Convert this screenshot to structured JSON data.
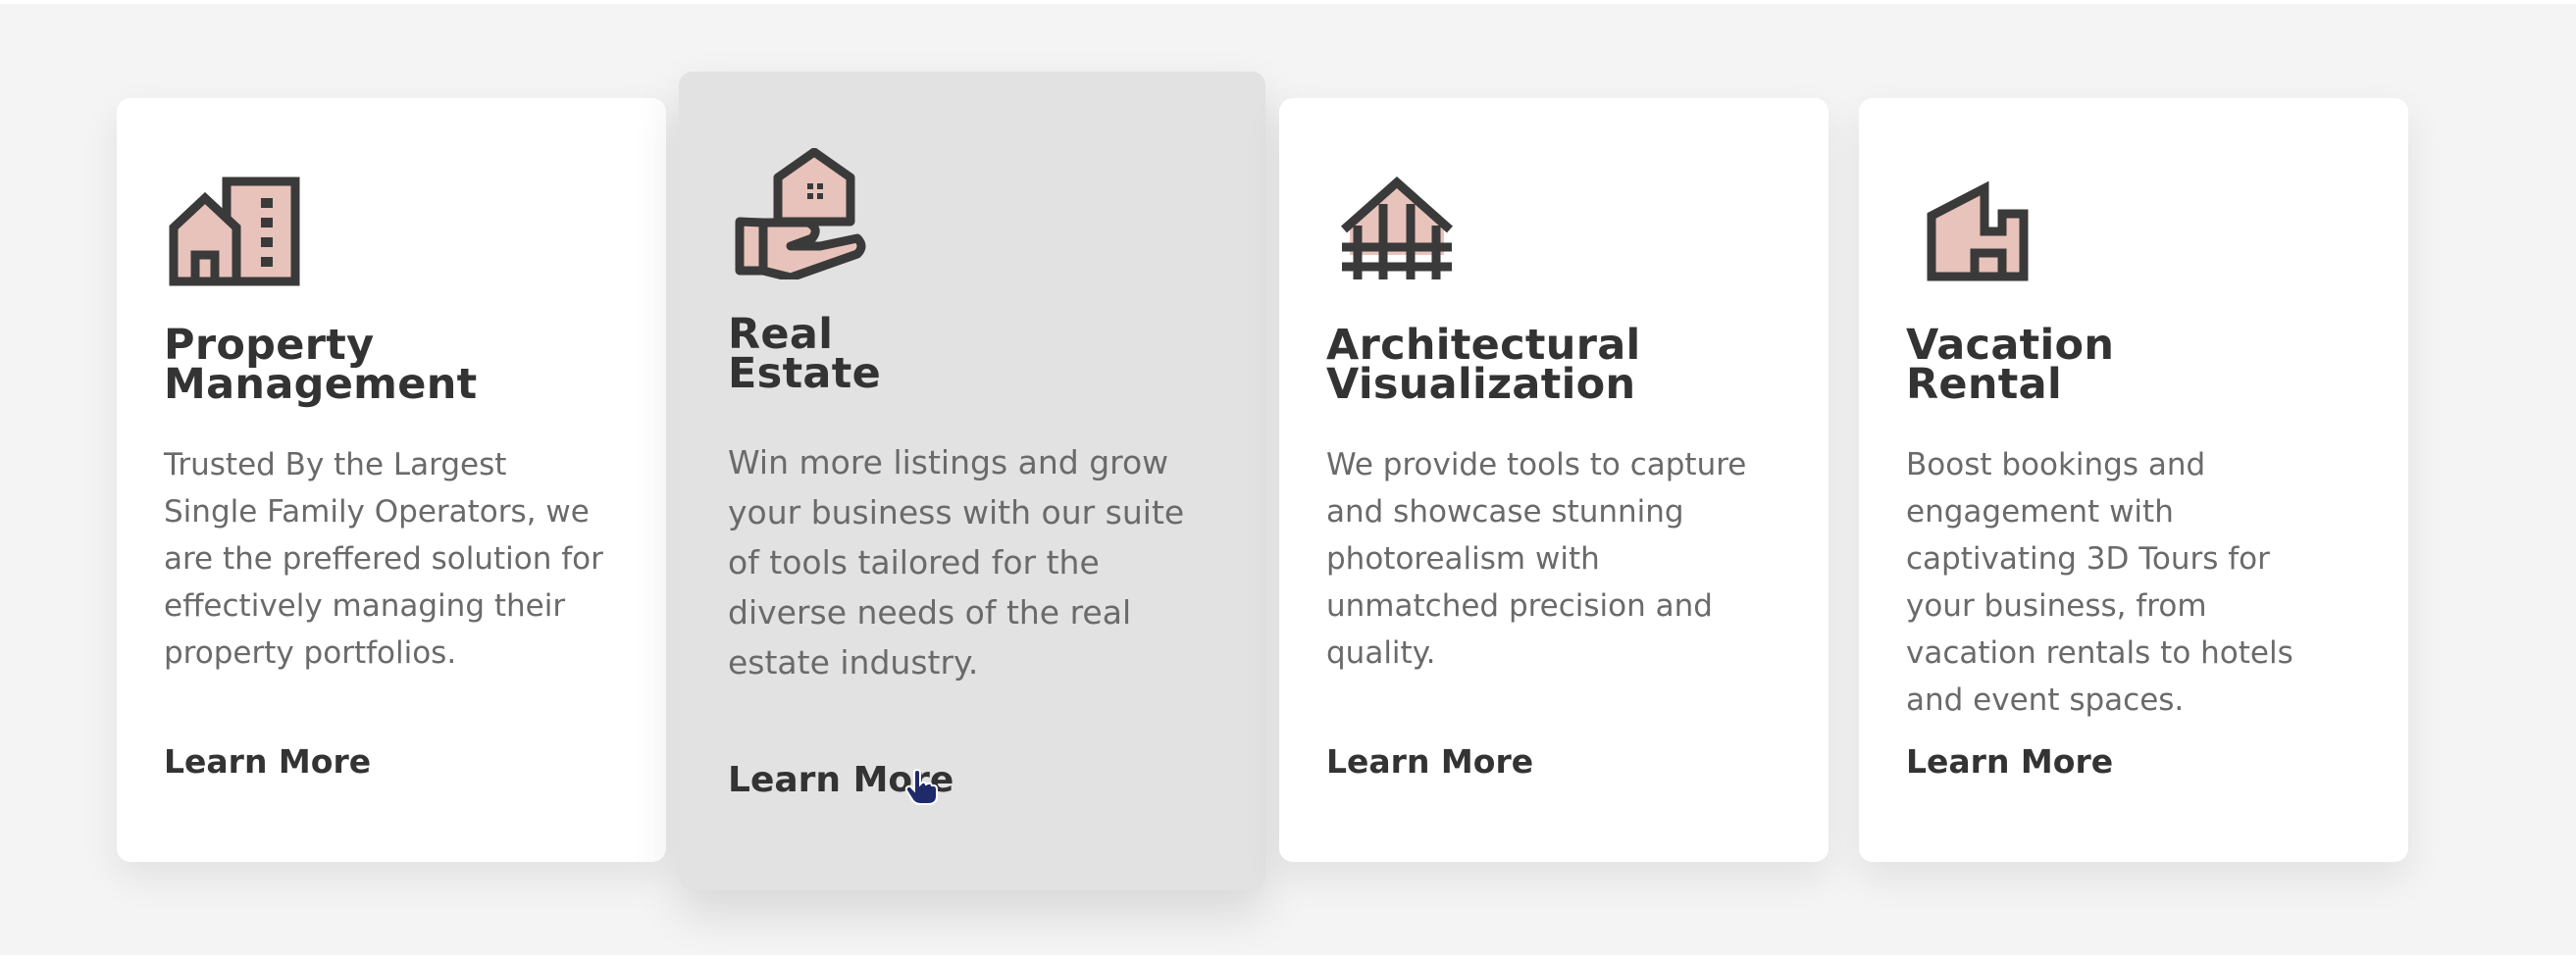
{
  "colors": {
    "page_background": "#f4f4f4",
    "card_background": "#ffffff",
    "card_hover_background": "#e2e2e2",
    "heading": "#333333",
    "body_text": "#6a6a6a",
    "icon_stroke": "#3a3a3a",
    "icon_fill": "#e8c3bb"
  },
  "cards": [
    {
      "icon": "buildings-icon",
      "title_line1": "Property",
      "title_line2": "Management",
      "description": "Trusted By the Largest Single Family Operators, we are the preffered solution for effectively managing their property portfolios.",
      "link_label": "Learn More",
      "state": "default"
    },
    {
      "icon": "house-in-hand-icon",
      "title_line1": "Real",
      "title_line2": "Estate",
      "description": "Win more listings and grow your business with our suite of tools tailored for the diverse needs of the real estate industry.",
      "link_label": "Learn More",
      "state": "hovered"
    },
    {
      "icon": "framed-house-icon",
      "title_line1": "Architectural",
      "title_line2": "Visualization",
      "description": "We provide tools to capture and showcase stunning photorealism with unmatched precision and quality.",
      "link_label": "Learn More",
      "state": "default"
    },
    {
      "icon": "hotel-building-icon",
      "title_line1": "Vacation",
      "title_line2": "Rental",
      "description": "Boost bookings and engagement with captivating 3D Tours for your business, from vacation rentals to hotels and event spaces.",
      "link_label": "Learn More",
      "state": "default"
    }
  ]
}
